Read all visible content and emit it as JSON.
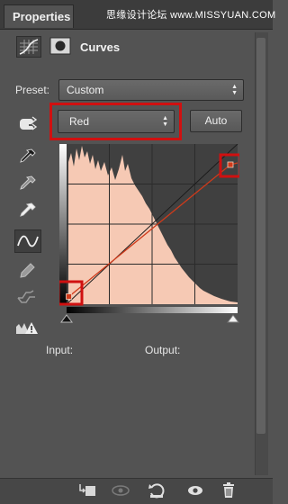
{
  "panel": {
    "tab_label": "Properties",
    "watermark": "思缘设计论坛 www.MISSYUAN.COM"
  },
  "header": {
    "title": "Curves",
    "adjustment_icon": "curves-adjustment-icon",
    "mask_icon": "layer-mask-icon"
  },
  "preset": {
    "label": "Preset:",
    "value": "Custom"
  },
  "channel": {
    "value": "Red",
    "auto_label": "Auto"
  },
  "tools": [
    "on-image-adjust-icon",
    "sample-black-point-eyedropper-icon",
    "sample-gray-point-eyedropper-icon",
    "sample-white-point-eyedropper-icon",
    "edit-points-curve-icon",
    "draw-pencil-icon",
    "smooth-curve-icon",
    "clipping-warning-icon"
  ],
  "curve": {
    "channel_color": "#d03a1a",
    "histogram_color": "#f6c9b4",
    "graph_bg": "#404040"
  },
  "labels": {
    "input": "Input:",
    "output": "Output:"
  },
  "bottom_icons": [
    "clip-to-layer-icon",
    "view-previous-state-icon",
    "reset-adjustment-icon",
    "toggle-visibility-icon",
    "delete-adjustment-icon"
  ],
  "colors": {
    "highlight": "#d01010",
    "panel_bg": "#535353"
  }
}
